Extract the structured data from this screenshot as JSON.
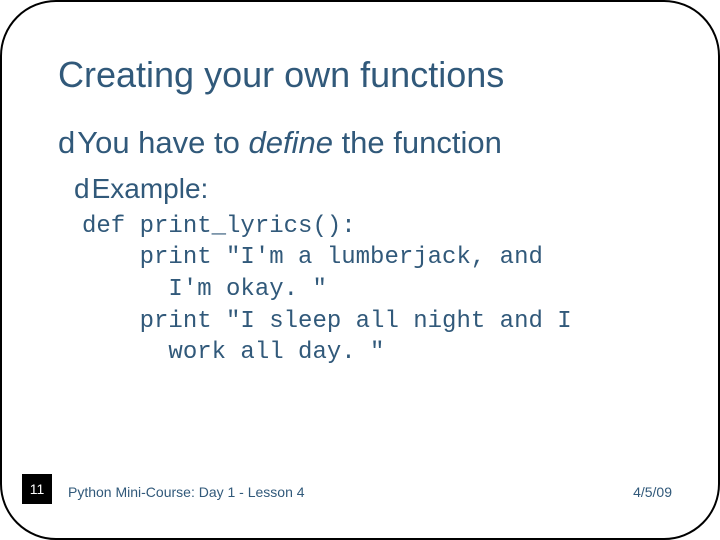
{
  "title": "Creating your own functions",
  "bullet1_pre": "You have to ",
  "bullet1_em": "define",
  "bullet1_post": " the function",
  "bullet2": "Example:",
  "code": "def print_lyrics():\n    print \"I'm a lumberjack, and\n      I'm okay. \"\n    print \"I sleep all night and I\n      work all day. \"",
  "page_num": "11",
  "course": "Python Mini-Course: Day 1 - Lesson 4",
  "date": "4/5/09",
  "bullet_glyph": "d"
}
